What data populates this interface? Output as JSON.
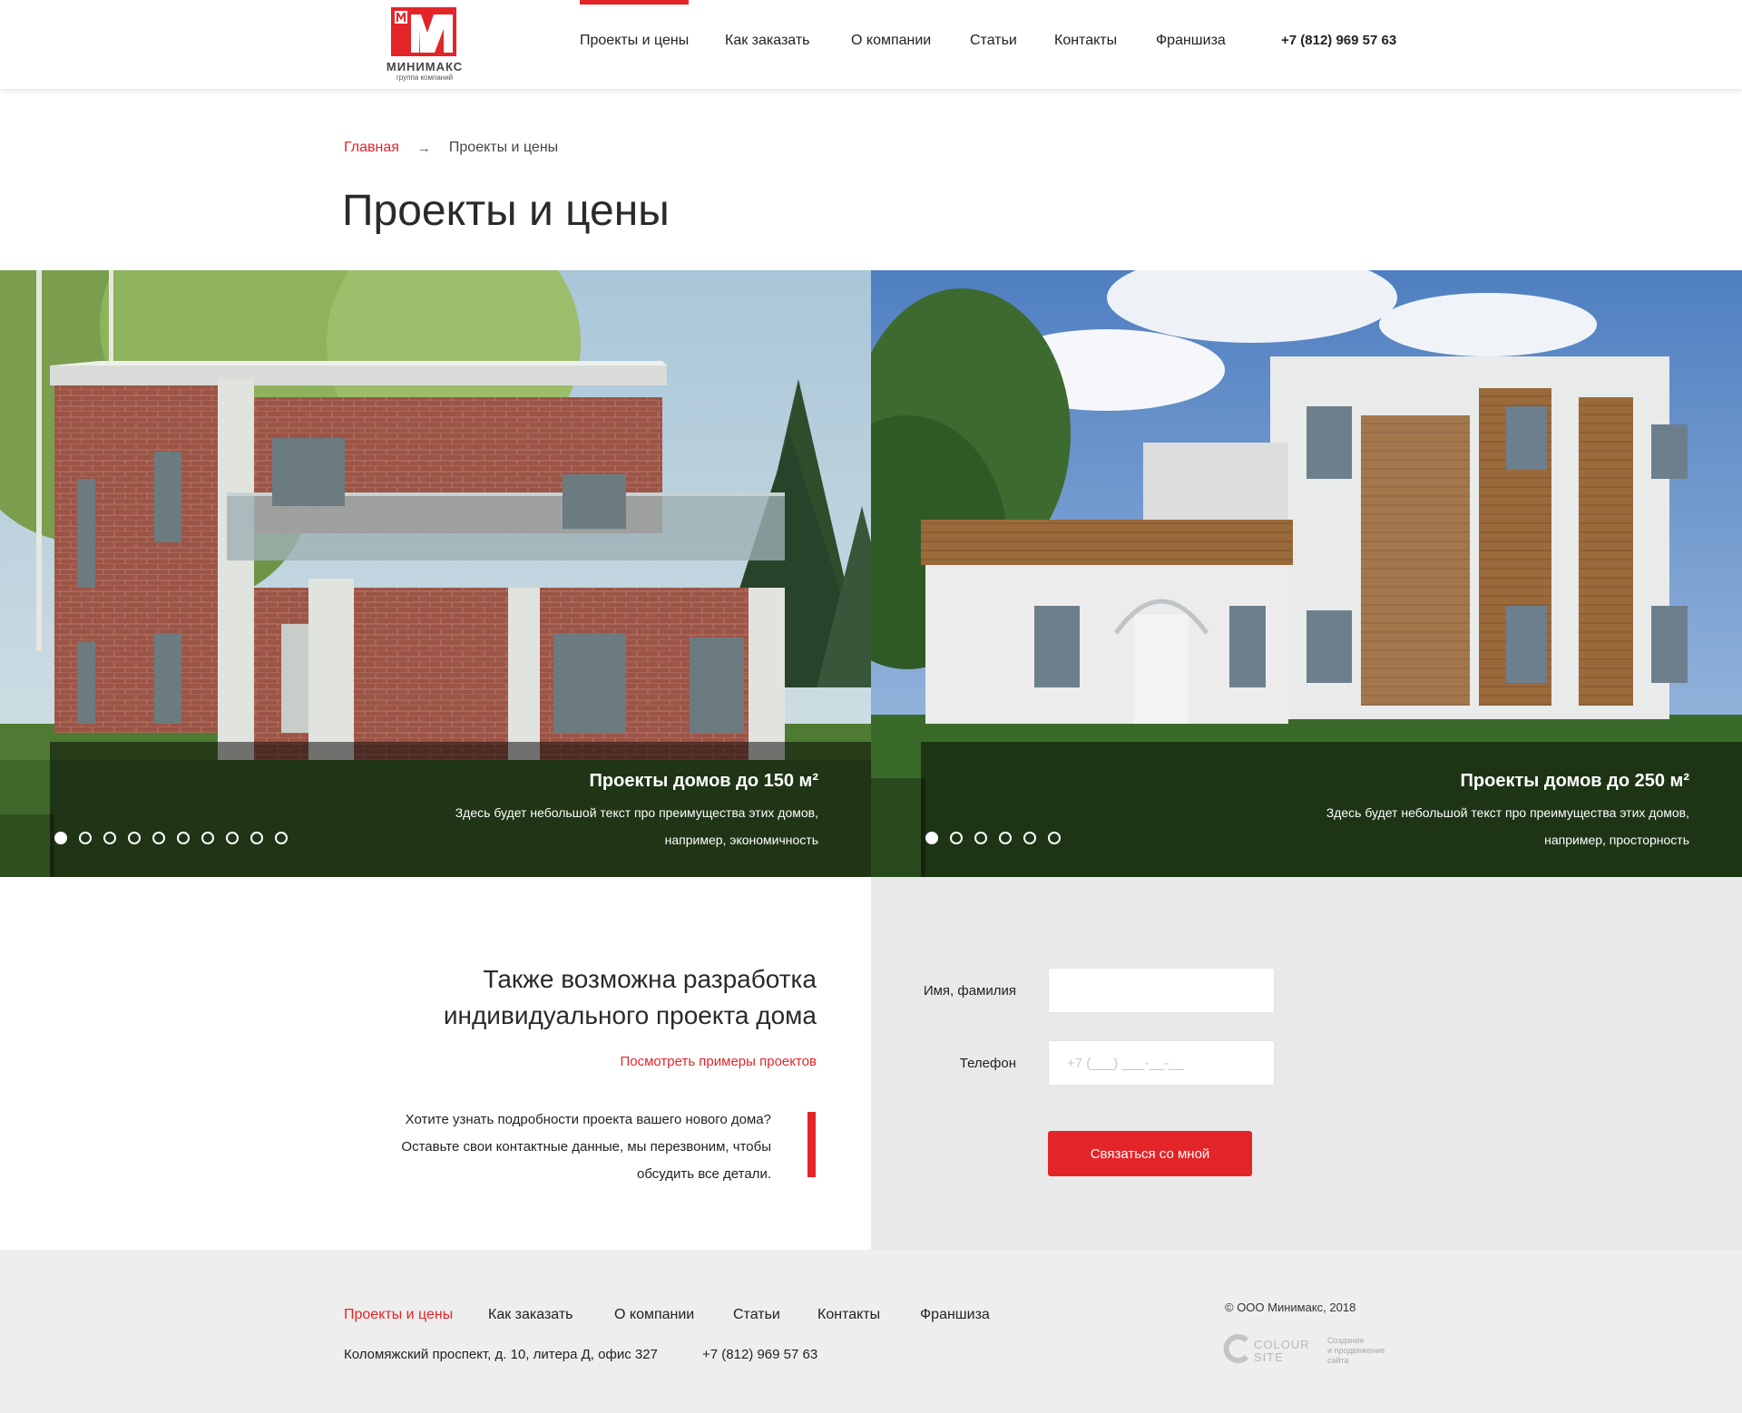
{
  "header": {
    "logo": {
      "name": "МИНИМАКС",
      "subtitle": "группа компаний",
      "brand_color": "#e32529"
    },
    "nav": [
      {
        "label": "Проекты и цены",
        "active": true
      },
      {
        "label": "Как заказать",
        "active": false
      },
      {
        "label": "О компании",
        "active": false
      },
      {
        "label": "Статьи",
        "active": false
      },
      {
        "label": "Контакты",
        "active": false
      },
      {
        "label": "Франшиза",
        "active": false
      }
    ],
    "phone": "+7 (812) 969 57 63"
  },
  "breadcrumb": {
    "home": "Главная",
    "current": "Проекты и цены"
  },
  "page_title": "Проекты и цены",
  "slides": [
    {
      "title": "Проекты домов до 150 м²",
      "text": "Здесь будет небольшой текст про преимущества этих домов, например, экономичность",
      "dots_total": 10,
      "active_dot": 1
    },
    {
      "title": "Проекты домов до 250 м²",
      "text": "Здесь будет небольшой текст про преимущества этих домов, например, просторность",
      "dots_total": 6,
      "active_dot": 1
    }
  ],
  "cta": {
    "title_line1": "Также возможна разработка",
    "title_line2": "индивидуального проекта дома",
    "link": "Посмотреть примеры проектов",
    "text": "Хотите узнать подробности проекта вашего нового дома? Оставьте свои контактные данные, мы перезвоним, чтобы обсудить все детали."
  },
  "form": {
    "name_label": "Имя, фамилия",
    "name_value": "",
    "phone_label": "Телефон",
    "phone_placeholder": "+7 (___) ___-__-__",
    "submit_label": "Связаться со мной"
  },
  "footer": {
    "nav": [
      {
        "label": "Проекты и цены",
        "active": true
      },
      {
        "label": "Как заказать",
        "active": false
      },
      {
        "label": "О компании",
        "active": false
      },
      {
        "label": "Статьи",
        "active": false
      },
      {
        "label": "Контакты",
        "active": false
      },
      {
        "label": "Франшиза",
        "active": false
      }
    ],
    "address": "Коломяжский проспект, д. 10, литера Д, офис 327",
    "phone": "+7 (812) 969 57 63",
    "copyright": "© ООО Минимакс, 2018",
    "developer_line1": "COLOUR",
    "developer_line2": "SITE",
    "developer_desc1": "Создание",
    "developer_desc2": "и продвижение",
    "developer_desc3": "сайта"
  }
}
